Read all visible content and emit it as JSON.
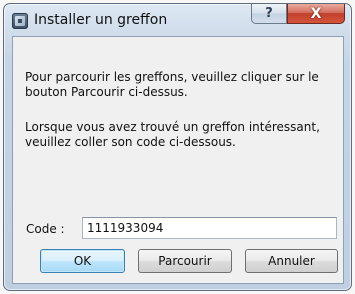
{
  "window": {
    "title": "Installer un greffon",
    "help_glyph": "?",
    "close_glyph": "X",
    "icon": "app-icon"
  },
  "message": {
    "line1": "Pour parcourir les greffons, veuillez cliquer sur le bouton Parcourir ci-dessus.",
    "line2": "Lorsque vous avez trouvé un greffon intéressant, veuillez coller son code ci-dessous."
  },
  "code": {
    "label": "Code :",
    "value": "1111933094"
  },
  "buttons": {
    "ok": "OK",
    "browse": "Parcourir",
    "cancel": "Annuler"
  },
  "colors": {
    "close_button": "#c2402b",
    "default_button_border": "#3c7fb1"
  }
}
